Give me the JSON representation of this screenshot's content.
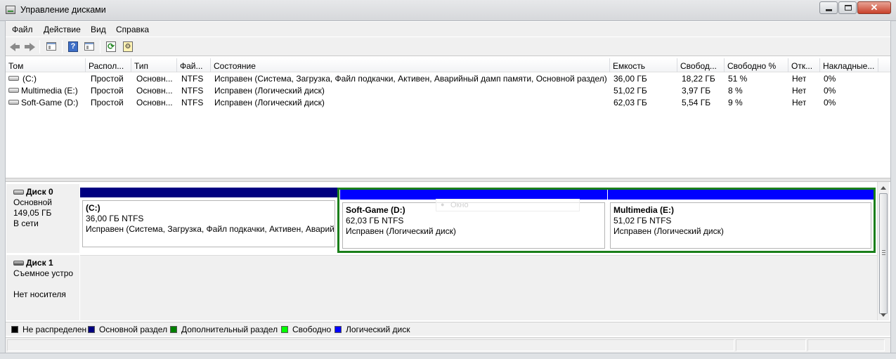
{
  "window": {
    "title": "Управление дисками"
  },
  "menu": [
    "Файл",
    "Действие",
    "Вид",
    "Справка"
  ],
  "toolbar": {
    "icons": [
      "back-arrow",
      "forward-arrow",
      "show-hide-console-tree",
      "help",
      "show-hide-action-pane",
      "refresh",
      "properties"
    ],
    "help_glyph": "?",
    "refresh_glyph": "⟳",
    "props_glyph": "⚙"
  },
  "volume_list": {
    "columns": [
      "Том",
      "Распол...",
      "Тип",
      "Фай...",
      "Состояние",
      "Емкость",
      "Свобод...",
      "Свободно %",
      "Отк...",
      "Накладные..."
    ],
    "rows": [
      {
        "volume": "(C:)",
        "layout": "Простой",
        "type": "Основн...",
        "fs": "NTFS",
        "status": "Исправен (Система, Загрузка, Файл подкачки, Активен, Аварийный дамп памяти, Основной раздел)",
        "capacity": "36,00 ГБ",
        "free": "18,22 ГБ",
        "free_pct": "51 %",
        "fault": "Нет",
        "overhead": "0%"
      },
      {
        "volume": "Multimedia (E:)",
        "layout": "Простой",
        "type": "Основн...",
        "fs": "NTFS",
        "status": "Исправен (Логический диск)",
        "capacity": "51,02 ГБ",
        "free": "3,97 ГБ",
        "free_pct": "8 %",
        "fault": "Нет",
        "overhead": "0%"
      },
      {
        "volume": "Soft-Game (D:)",
        "layout": "Простой",
        "type": "Основн...",
        "fs": "NTFS",
        "status": "Исправен (Логический диск)",
        "capacity": "62,03 ГБ",
        "free": "5,54 ГБ",
        "free_pct": "9 %",
        "fault": "Нет",
        "overhead": "0%"
      }
    ]
  },
  "disks": [
    {
      "name": "Диск 0",
      "lines": [
        "Основной",
        "149,05 ГБ",
        "В сети"
      ],
      "partitions": [
        {
          "name": "(C:)",
          "size": "36,00 ГБ NTFS",
          "status": "Исправен (Система, Загрузка, Файл подкачки, Активен, Аварий",
          "kind": "primary"
        },
        {
          "name": "Soft-Game  (D:)",
          "size": "62,03 ГБ NTFS",
          "status": "Исправен (Логический диск)",
          "kind": "logical"
        },
        {
          "name": "Multimedia  (E:)",
          "size": "51,02 ГБ NTFS",
          "status": "Исправен (Логический диск)",
          "kind": "logical"
        }
      ]
    },
    {
      "name": "Диск 1",
      "lines": [
        "Съемное устро",
        "",
        "Нет носителя"
      ]
    }
  ],
  "ghost_tooltip": "Окно",
  "legend": [
    {
      "label": "Не распределен",
      "color": "#000000"
    },
    {
      "label": "Основной раздел",
      "color": "#000080"
    },
    {
      "label": "Дополнительный раздел",
      "color": "#008000"
    },
    {
      "label": "Свободно",
      "color": "#00ff00"
    },
    {
      "label": "Логический диск",
      "color": "#0000ff"
    }
  ],
  "colors": {
    "primary_bar": "#000080",
    "logical_bar": "#0000ff",
    "extended_frame": "#1a7f1a"
  }
}
